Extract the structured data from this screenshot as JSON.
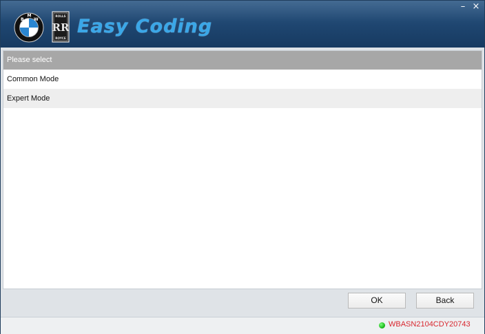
{
  "header": {
    "brand_text": "Easy Coding",
    "bmw_letters": [
      "B",
      "M",
      "W"
    ],
    "rr_top_text": "ROLLS",
    "rr_bottom_text": "ROYCE",
    "rr_monogram": "RR",
    "minimize_glyph": "–",
    "close_glyph": "×"
  },
  "list": {
    "header": "Please select",
    "items": [
      {
        "label": "Common Mode"
      },
      {
        "label": "Expert Mode"
      }
    ]
  },
  "buttons": {
    "ok_label": "OK",
    "back_label": "Back"
  },
  "status": {
    "vin": "WBASN2104CDY20743",
    "indicator_color": "#10b010"
  },
  "colors": {
    "header_bg": "#1e456f",
    "brand_accent": "#3aa7e8",
    "vin_text": "#d8262e",
    "list_header_bg": "#a7a7a7"
  }
}
